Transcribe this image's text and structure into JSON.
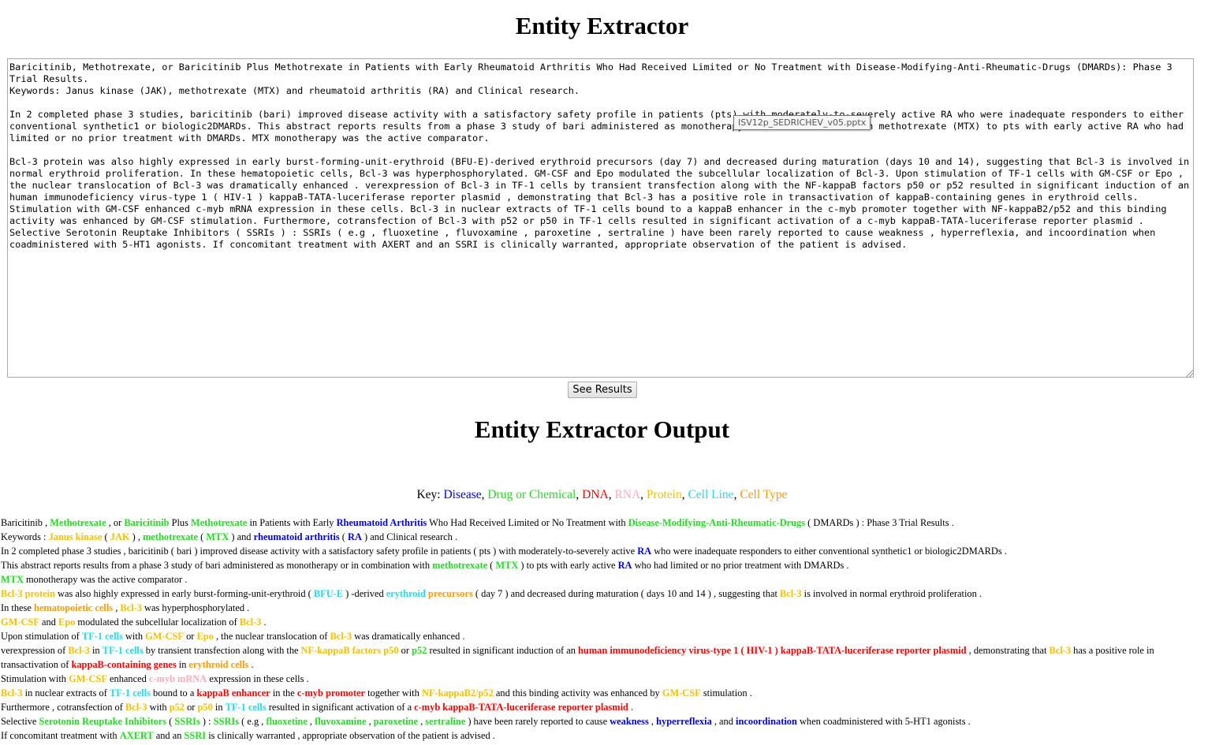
{
  "page": {
    "title": "Entity Extractor"
  },
  "input": {
    "text": "Baricitinib, Methotrexate, or Baricitinib Plus Methotrexate in Patients with Early Rheumatoid Arthritis Who Had Received Limited or No Treatment with Disease-Modifying-Anti-Rheumatic-Drugs (DMARDs): Phase 3 Trial Results.\nKeywords: Janus kinase (JAK), methotrexate (MTX) and rheumatoid arthritis (RA) and Clinical research.\n\nIn 2 completed phase 3 studies, baricitinib (bari) improved disease activity with a satisfactory safety profile in patients (pts) with moderately-to-severely active RA who were inadequate responders to either conventional synthetic1 or biologic2DMARDs. This abstract reports results from a phase 3 study of bari administered as monotherapy or in combination with methotrexate (MTX) to pts with early active RA who had limited or no prior treatment with DMARDs. MTX monotherapy was the active comparator.\n\nBcl-3 protein was also highly expressed in early burst-forming-unit-erythroid (BFU-E)-derived erythroid precursors (day 7) and decreased during maturation (days 10 and 14), suggesting that Bcl-3 is involved in normal erythroid proliferation. In these hematopoietic cells, Bcl-3 was hyperphosphorylated. GM-CSF and Epo modulated the subcellular localization of Bcl-3. Upon stimulation of TF-1 cells with GM-CSF or Epo , the nuclear translocation of Bcl-3 was dramatically enhanced . verexpression of Bcl-3 in TF-1 cells by transient transfection along with the NF-kappaB factors p50 or p52 resulted in significant induction of an human immunodeficiency virus-type 1 ( HIV-1 ) kappaB-TATA-luceriferase reporter plasmid , demonstrating that Bcl-3 has a positive role in transactivation of kappaB-containing genes in erythroid cells. Stimulation with GM-CSF enhanced c-myb mRNA expression in these cells. Bcl-3 in nuclear extracts of TF-1 cells bound to a kappaB enhancer in the c-myb promoter together with NF-kappaB2/p52 and this binding activity was enhanced by GM-CSF stimulation. Furthermore, cotransfection of Bcl-3 with p52 or p50 in TF-1 cells resulted in significant activation of a c-myb kappaB-TATA-luceriferase reporter plasmid . Selective Serotonin Reuptake Inhibitors ( SSRIs ) : SSRIs ( e.g , fluoxetine , fluvoxamine , paroxetine , sertraline ) have been rarely reported to cause weakness , hyperreflexia, and incoordination when coadministered with 5-HT1 agonists. If concomitant treatment with AXERT and an SSRI is clinically warranted, appropriate observation of the patient is advised.",
    "tooltip": "ISV12p_SEDRICHEV_v05.pptx"
  },
  "button": {
    "label": "See Results"
  },
  "output": {
    "title": "Entity Extractor Output",
    "key_label": "Key:",
    "categories": [
      {
        "label": "Disease",
        "cls": "c-disease"
      },
      {
        "label": "Drug or Chemical",
        "cls": "c-drug"
      },
      {
        "label": "DNA",
        "cls": "c-dna"
      },
      {
        "label": "RNA",
        "cls": "c-rna"
      },
      {
        "label": "Protein",
        "cls": "c-protein"
      },
      {
        "label": "Cell Line",
        "cls": "c-cellline"
      },
      {
        "label": "Cell Type",
        "cls": "c-celltype"
      }
    ],
    "lines": [
      [
        [
          "Baricitinib , "
        ],
        [
          "Methotrexate",
          "c-drug"
        ],
        [
          " , or "
        ],
        [
          "Baricitinib",
          "c-drug"
        ],
        [
          " Plus "
        ],
        [
          "Methotrexate",
          "c-drug"
        ],
        [
          " in Patients with Early "
        ],
        [
          "Rheumatoid Arthritis",
          "c-disease"
        ],
        [
          " Who Had Received Limited or No Treatment with "
        ],
        [
          "Disease-Modifying-Anti-Rheumatic-Drugs",
          "c-drug"
        ],
        [
          " ( DMARDs ) : Phase 3 Trial Results ."
        ]
      ],
      [
        [
          "Keywords : "
        ],
        [
          "Janus kinase",
          "c-protein"
        ],
        [
          " ( "
        ],
        [
          "JAK",
          "c-protein"
        ],
        [
          " ) , "
        ],
        [
          "methotrexate",
          "c-drug"
        ],
        [
          " ( "
        ],
        [
          "MTX",
          "c-drug"
        ],
        [
          " ) and "
        ],
        [
          "rheumatoid arthritis",
          "c-disease"
        ],
        [
          " ( "
        ],
        [
          "RA",
          "c-disease"
        ],
        [
          " ) and Clinical research ."
        ]
      ],
      [
        [
          "In 2 completed phase 3 studies , baricitinib ( bari ) improved disease activity with a satisfactory safety profile in patients ( pts ) with moderately-to-severely active "
        ],
        [
          "RA",
          "c-disease"
        ],
        [
          " who were inadequate responders to either conventional synthetic1 or biologic2DMARDs ."
        ]
      ],
      [
        [
          "This abstract reports results from a phase 3 study of bari administered as monotherapy or in combination with "
        ],
        [
          "methotrexate",
          "c-drug"
        ],
        [
          " ( "
        ],
        [
          "MTX",
          "c-drug"
        ],
        [
          " ) to pts with early active "
        ],
        [
          "RA",
          "c-disease"
        ],
        [
          " who had limited or no prior treatment with DMARDs ."
        ]
      ],
      [
        [
          "MTX",
          "c-drug"
        ],
        [
          " monotherapy was the active comparator ."
        ]
      ],
      [
        [
          "Bcl-3 protein",
          "c-protein"
        ],
        [
          " was also highly expressed in early burst-forming-unit-erythroid ( "
        ],
        [
          "BFU-E",
          "c-cellline"
        ],
        [
          " ) -derived "
        ],
        [
          "erythroid",
          "c-cellline"
        ],
        [
          " "
        ],
        [
          "precursors",
          "c-celltype"
        ],
        [
          " ( day 7 ) and decreased during maturation ( days 10 and 14 ) , suggesting that "
        ],
        [
          "Bcl-3",
          "c-protein"
        ],
        [
          " is involved in normal erythroid proliferation ."
        ]
      ],
      [
        [
          "In these "
        ],
        [
          "hematopoietic cells",
          "c-celltype"
        ],
        [
          " , "
        ],
        [
          "Bcl-3",
          "c-protein"
        ],
        [
          " was hyperphosphorylated ."
        ]
      ],
      [
        [
          "GM-CSF",
          "c-protein"
        ],
        [
          " and "
        ],
        [
          "Epo",
          "c-protein"
        ],
        [
          " modulated the subcellular localization of "
        ],
        [
          "Bcl-3",
          "c-protein"
        ],
        [
          " ."
        ]
      ],
      [
        [
          "Upon stimulation of "
        ],
        [
          "TF-1 cells",
          "c-cellline"
        ],
        [
          " with "
        ],
        [
          "GM-CSF",
          "c-protein"
        ],
        [
          " or "
        ],
        [
          "Epo",
          "c-protein"
        ],
        [
          " , the nuclear translocation of "
        ],
        [
          "Bcl-3",
          "c-protein"
        ],
        [
          " was dramatically enhanced ."
        ]
      ],
      [
        [
          "verexpression of "
        ],
        [
          "Bcl-3",
          "c-protein"
        ],
        [
          " in "
        ],
        [
          "TF-1 cells",
          "c-cellline"
        ],
        [
          " by transient transfection along with the "
        ],
        [
          "NF-kappaB factors p50",
          "c-protein"
        ],
        [
          " or "
        ],
        [
          "p52",
          "c-drug"
        ],
        [
          " resulted in significant induction of an "
        ],
        [
          "human immunodeficiency virus-type 1 ( HIV-1 ) kappaB-TATA-luceriferase reporter plasmid",
          "c-dna"
        ],
        [
          " , demonstrating that "
        ],
        [
          "Bcl-3",
          "c-protein"
        ],
        [
          " has a positive role in transactivation of "
        ],
        [
          "kappaB-containing genes",
          "c-dna"
        ],
        [
          " in "
        ],
        [
          "erythroid cells",
          "c-celltype"
        ],
        [
          " ."
        ]
      ],
      [
        [
          "Stimulation with "
        ],
        [
          "GM-CSF",
          "c-protein"
        ],
        [
          " enhanced "
        ],
        [
          "c-myb mRNA",
          "c-rna"
        ],
        [
          " expression in these cells ."
        ]
      ],
      [
        [
          "Bcl-3",
          "c-protein"
        ],
        [
          " in nuclear extracts of "
        ],
        [
          "TF-1 cells",
          "c-cellline"
        ],
        [
          " bound to a "
        ],
        [
          "kappaB enhancer",
          "c-dna"
        ],
        [
          " in the "
        ],
        [
          "c-myb promoter",
          "c-dna"
        ],
        [
          " together with "
        ],
        [
          "NF-kappaB2/p52",
          "c-protein"
        ],
        [
          " and this binding activity was enhanced by "
        ],
        [
          "GM-CSF",
          "c-protein"
        ],
        [
          " stimulation ."
        ]
      ],
      [
        [
          "Furthermore , cotransfection of "
        ],
        [
          "Bcl-3",
          "c-protein"
        ],
        [
          " with "
        ],
        [
          "p52",
          "c-protein"
        ],
        [
          " or "
        ],
        [
          "p50",
          "c-protein"
        ],
        [
          " in "
        ],
        [
          "TF-1 cells",
          "c-cellline"
        ],
        [
          " resulted in significant activation of a "
        ],
        [
          "c-myb kappaB-TATA-luceriferase reporter plasmid",
          "c-dna"
        ],
        [
          " ."
        ]
      ],
      [
        [
          "Selective "
        ],
        [
          "Serotonin Reuptake Inhibitors",
          "c-drug"
        ],
        [
          " ( "
        ],
        [
          "SSRIs",
          "c-drug"
        ],
        [
          " ) : "
        ],
        [
          "SSRIs",
          "c-drug"
        ],
        [
          " ( e.g , "
        ],
        [
          "fluoxetine",
          "c-drug"
        ],
        [
          " , "
        ],
        [
          "fluvoxamine",
          "c-drug"
        ],
        [
          " , "
        ],
        [
          "paroxetine",
          "c-drug"
        ],
        [
          " , "
        ],
        [
          "sertraline",
          "c-drug"
        ],
        [
          " ) have been rarely reported to cause "
        ],
        [
          "weakness",
          "c-disease"
        ],
        [
          " , "
        ],
        [
          "hyperreflexia",
          "c-disease"
        ],
        [
          " , and "
        ],
        [
          "incoordination",
          "c-disease"
        ],
        [
          " when coadministered with 5-HT1 agonists ."
        ]
      ],
      [
        [
          "If concomitant treatment with "
        ],
        [
          "AXERT",
          "c-drug"
        ],
        [
          " and an "
        ],
        [
          "SSRI",
          "c-drug"
        ],
        [
          " is clinically warranted , appropriate observation of the patient is advised ."
        ]
      ]
    ]
  }
}
